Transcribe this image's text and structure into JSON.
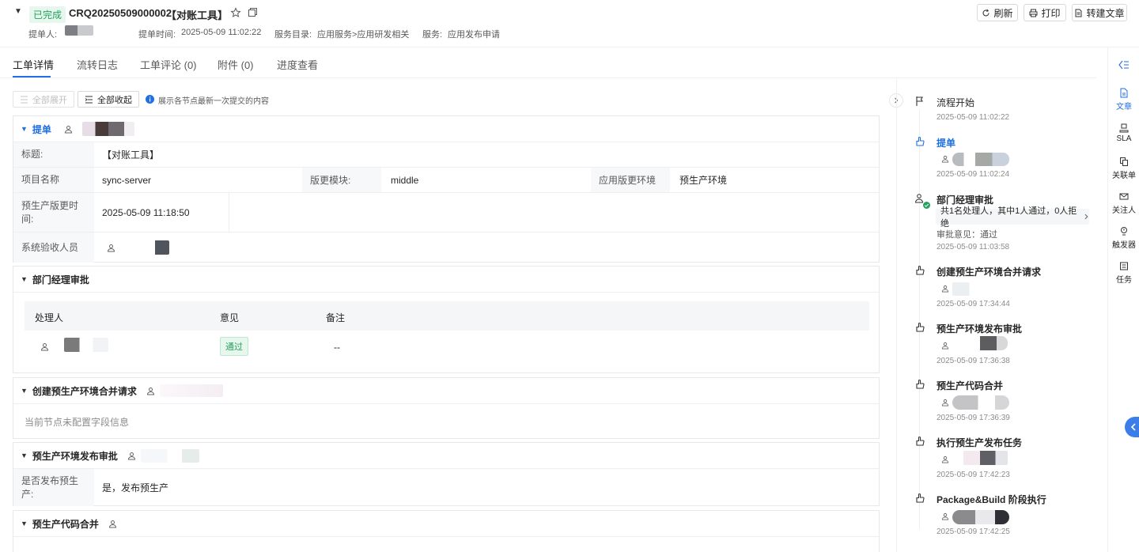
{
  "header": {
    "status": "已完成",
    "ticket_id": "CRQ20250509000002",
    "ticket_title": "【对账工具】",
    "submitter_label": "提单人:",
    "submit_time_label": "提单时间:",
    "submit_time": "2025-05-09 11:02:22",
    "catalog_label": "服务目录:",
    "catalog_value": "应用服务>应用研发相关",
    "service_label": "服务:",
    "service_value": "应用发布申请",
    "refresh_label": "刷新",
    "print_label": "打印",
    "convert_label": "转建文章"
  },
  "tabs": [
    {
      "label": "工单详情"
    },
    {
      "label": "流转日志"
    },
    {
      "label": "工单评论 (0)"
    },
    {
      "label": "附件 (0)"
    },
    {
      "label": "进度查看"
    }
  ],
  "toolbar": {
    "expand_all": "全部展开",
    "collapse_all": "全部收起",
    "hint": "展示各节点最新一次提交的内容"
  },
  "sections": {
    "submit": {
      "title": "提单",
      "title_label": "标题:",
      "title_value": "【对账工具】",
      "project_label": "项目名称",
      "project_value": "sync-server",
      "module_label": "版更模块:",
      "module_value": "middle",
      "env_label": "应用版更环境",
      "env_value": "预生产环境",
      "time_label": "预生产版更时间:",
      "time_value": "2025-05-09 11:18:50",
      "acceptor_label": "系统验收人员"
    },
    "dept_approval": {
      "title": "部门经理审批",
      "col_handler": "处理人",
      "col_opinion": "意见",
      "col_remark": "备注",
      "opinion_value": "通过",
      "remark_value": "--"
    },
    "merge_request": {
      "title": "创建预生产环境合并请求",
      "empty": "当前节点未配置字段信息"
    },
    "release_approval": {
      "title": "预生产环境发布审批",
      "publish_label": "是否发布预生产:",
      "publish_value": "是，发布预生产"
    },
    "code_merge": {
      "title": "预生产代码合并"
    }
  },
  "timeline": [
    {
      "title": "流程开始",
      "time": "2025-05-09 11:02:22",
      "icon": "flag-icon"
    },
    {
      "title": "提单",
      "time": "2025-05-09 11:02:24",
      "icon": "hand-icon"
    },
    {
      "title": "部门经理审批",
      "summary": "共1名处理人，其中1人通过，0人拒绝",
      "opinion": "审批意见：通过",
      "time": "2025-05-09 11:03:58",
      "icon": "approver-icon"
    },
    {
      "title": "创建预生产环境合并请求",
      "time": "2025-05-09 17:34:44",
      "icon": "hand-icon"
    },
    {
      "title": "预生产环境发布审批",
      "time": "2025-05-09 17:36:38",
      "icon": "hand-icon"
    },
    {
      "title": "预生产代码合并",
      "time": "2025-05-09 17:36:39",
      "icon": "hand-icon"
    },
    {
      "title": "执行预生产发布任务",
      "time": "2025-05-09 17:42:23",
      "icon": "hand-icon"
    },
    {
      "title": "Package&Build 阶段执行",
      "time": "2025-05-09 17:42:25",
      "icon": "hand-icon"
    }
  ],
  "rail": [
    {
      "label": "文章",
      "icon": "document-icon"
    },
    {
      "label": "SLA",
      "icon": "sla-icon"
    },
    {
      "label": "关联单",
      "icon": "link-doc-icon"
    },
    {
      "label": "关注人",
      "icon": "mail-icon"
    },
    {
      "label": "触发器",
      "icon": "trigger-icon"
    },
    {
      "label": "任务",
      "icon": "task-icon"
    }
  ],
  "colors": {
    "accent": "#1f6fe5",
    "success": "#21a35b",
    "success_bg": "#e8f7ee"
  }
}
